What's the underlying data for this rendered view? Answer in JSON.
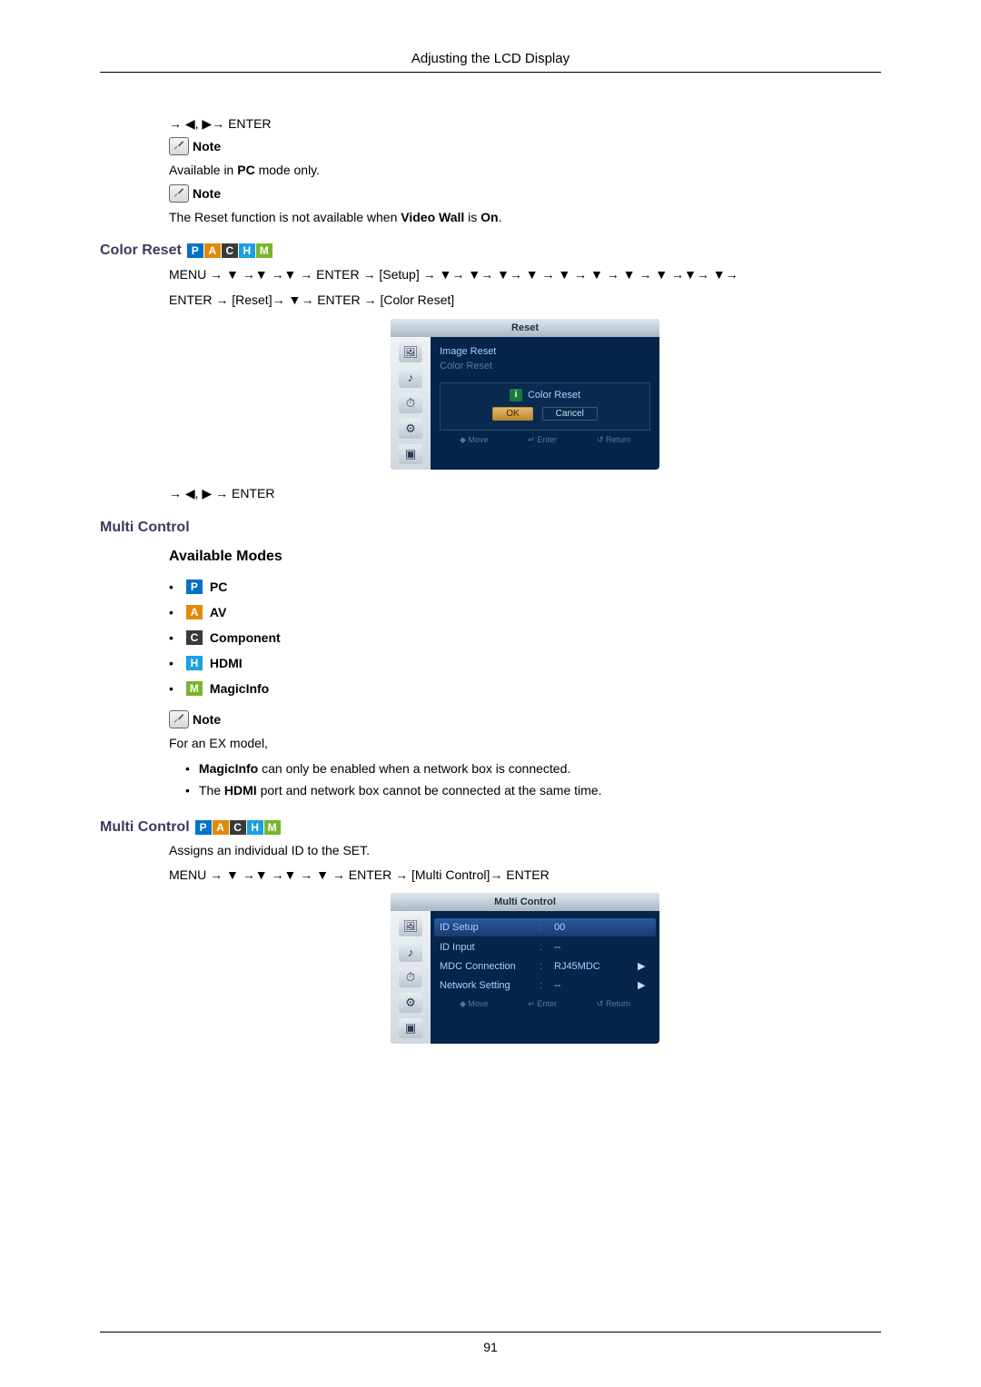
{
  "header": {
    "title": "Adjusting the LCD Display"
  },
  "top": {
    "arrow_enter": "→ ◀, ▶→ ENTER",
    "note_label": "Note",
    "note1": "Available in PC mode only.",
    "note1_bold": "PC",
    "note2_pre": "The Reset function is not available when ",
    "note2_b1": "Video Wall",
    "note2_mid": " is ",
    "note2_b2": "On",
    "note2_post": "."
  },
  "badges": {
    "P": "P",
    "A": "A",
    "C": "C",
    "H": "H",
    "M": "M"
  },
  "color_reset": {
    "title": "Color Reset",
    "path1": "MENU → ▼ →▼ →▼ → ENTER → [Setup] → ▼→ ▼→ ▼→ ▼ → ▼ → ▼ → ▼ → ▼ →▼→ ▼→",
    "path2": "ENTER → [Reset]→ ▼→ ENTER → [Color Reset]",
    "osd": {
      "title": "Reset",
      "items": [
        "Image Reset",
        "Color Reset"
      ],
      "confirm_title": "Color Reset",
      "ok": "OK",
      "cancel": "Cancel",
      "footer": {
        "move": "◆ Move",
        "enter": "↵ Enter",
        "return": "↺ Return"
      }
    },
    "arrow_enter": "→ ◀, ▶ → ENTER"
  },
  "multi_control": {
    "title": "Multi Control",
    "available_modes_title": "Available Modes",
    "modes": [
      {
        "badge": "P",
        "cls": "b-P",
        "label": "PC"
      },
      {
        "badge": "A",
        "cls": "b-A",
        "label": "AV"
      },
      {
        "badge": "C",
        "cls": "b-C",
        "label": "Component"
      },
      {
        "badge": "H",
        "cls": "b-H",
        "label": "HDMI"
      },
      {
        "badge": "M",
        "cls": "b-M",
        "label": "MagicInfo"
      }
    ],
    "note_label": "Note",
    "lead": "For an EX model,",
    "bullets": [
      {
        "b": "MagicInfo",
        "rest": " can only be enabled when a network box is connected."
      },
      {
        "b": "HDMI",
        "pre": "The ",
        "rest": " port and network box cannot be connected at the same time."
      }
    ]
  },
  "multi_control2": {
    "title": "Multi Control",
    "desc": "Assigns an individual ID to the SET.",
    "path": "MENU → ▼ →▼ →▼ → ▼ → ENTER → [Multi Control]→ ENTER",
    "osd": {
      "title": "Multi Control",
      "rows": [
        {
          "lbl": "ID Setup",
          "val": "00",
          "hl": true,
          "arrow": false
        },
        {
          "lbl": "ID Input",
          "val": "--",
          "hl": false,
          "arrow": false
        },
        {
          "lbl": "MDC Connection",
          "val": "RJ45MDC",
          "hl": false,
          "arrow": true
        },
        {
          "lbl": "Network Setting",
          "val": "--",
          "hl": false,
          "arrow": true
        }
      ],
      "footer": {
        "move": "◆ Move",
        "enter": "↵ Enter",
        "return": "↺ Return"
      }
    }
  },
  "page_number": "91"
}
